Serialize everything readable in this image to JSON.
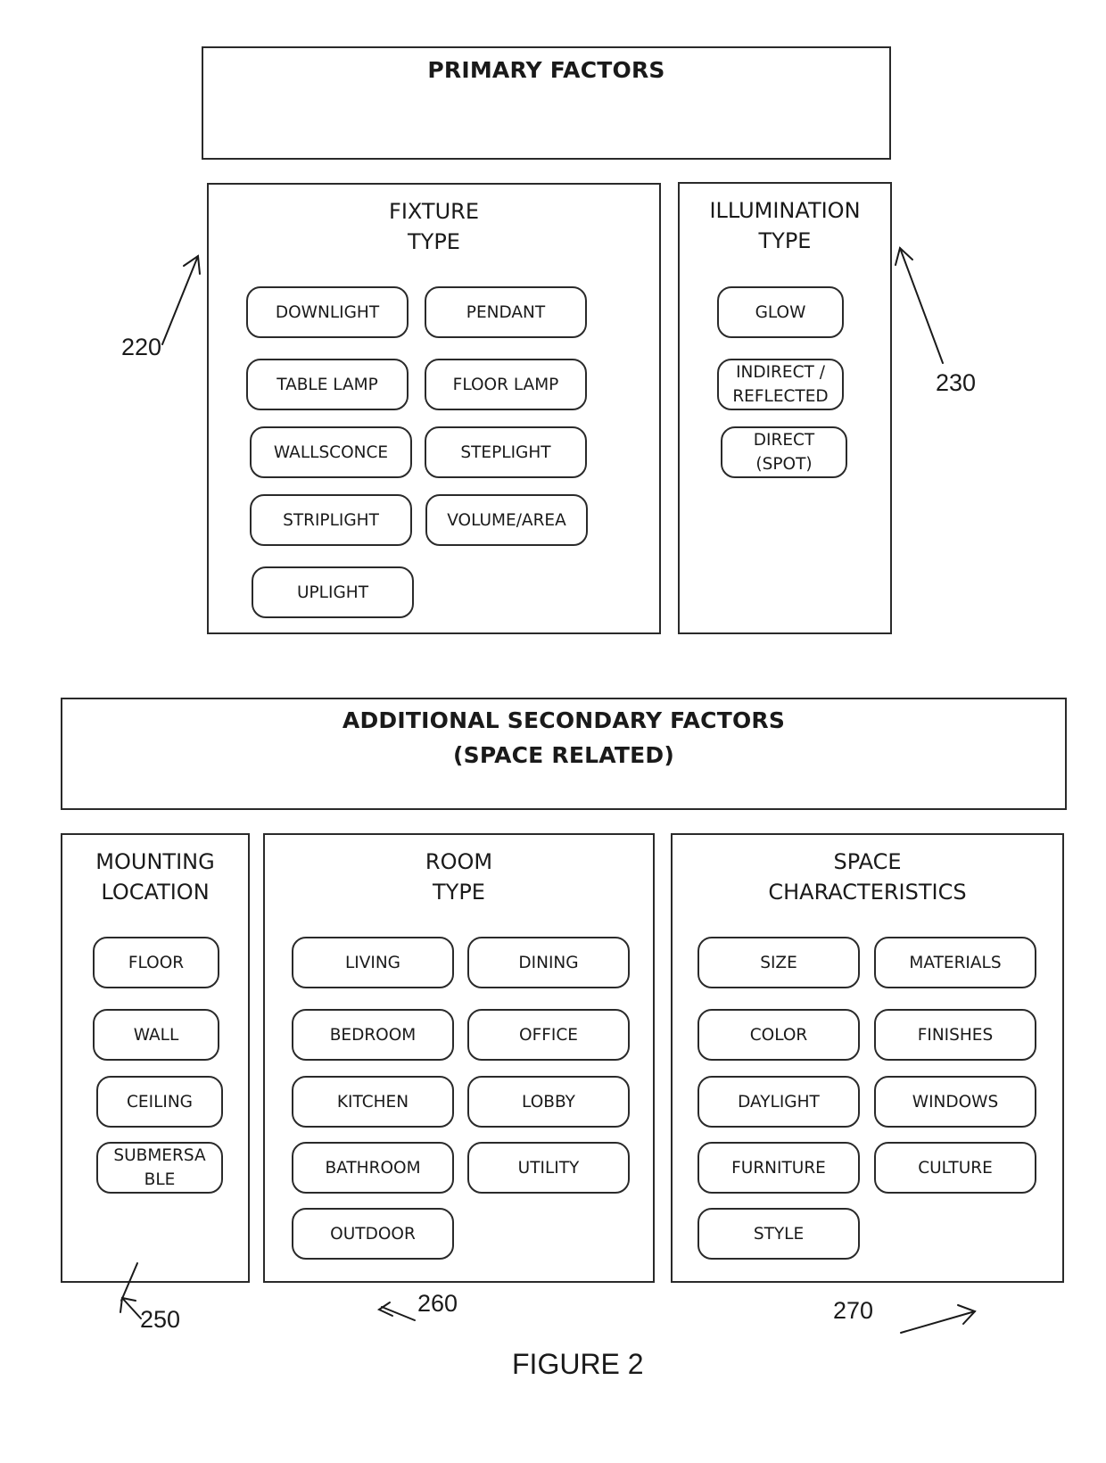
{
  "primary": {
    "header": "PRIMARY FACTORS",
    "fixture_type": {
      "title": "FIXTURE\nTYPE",
      "ref": "220",
      "items": [
        "DOWNLIGHT",
        "PENDANT",
        "TABLE LAMP",
        "FLOOR LAMP",
        "WALLSCONCE",
        "STEPLIGHT",
        "STRIPLIGHT",
        "VOLUME/AREA",
        "UPLIGHT"
      ]
    },
    "illumination_type": {
      "title": "ILLUMINATION\nTYPE",
      "ref": "230",
      "items": [
        "GLOW",
        "INDIRECT /\nREFLECTED",
        "DIRECT\n(SPOT)"
      ]
    }
  },
  "secondary": {
    "header_line1": "ADDITIONAL SECONDARY FACTORS",
    "header_line2": "(SPACE RELATED)",
    "mounting_location": {
      "title": "MOUNTING\nLOCATION",
      "ref": "250",
      "items": [
        "FLOOR",
        "WALL",
        "CEILING",
        "SUBMERSA\nBLE"
      ]
    },
    "room_type": {
      "title": "ROOM\nTYPE",
      "ref": "260",
      "items": [
        "LIVING",
        "DINING",
        "BEDROOM",
        "OFFICE",
        "KITCHEN",
        "LOBBY",
        "BATHROOM",
        "UTILITY",
        "OUTDOOR"
      ]
    },
    "space_characteristics": {
      "title": "SPACE\nCHARACTERISTICS",
      "ref": "270",
      "items": [
        "SIZE",
        "MATERIALS",
        "COLOR",
        "FINISHES",
        "DAYLIGHT",
        "WINDOWS",
        "FURNITURE",
        "CULTURE",
        "STYLE"
      ]
    }
  },
  "caption": "FIGURE 2"
}
